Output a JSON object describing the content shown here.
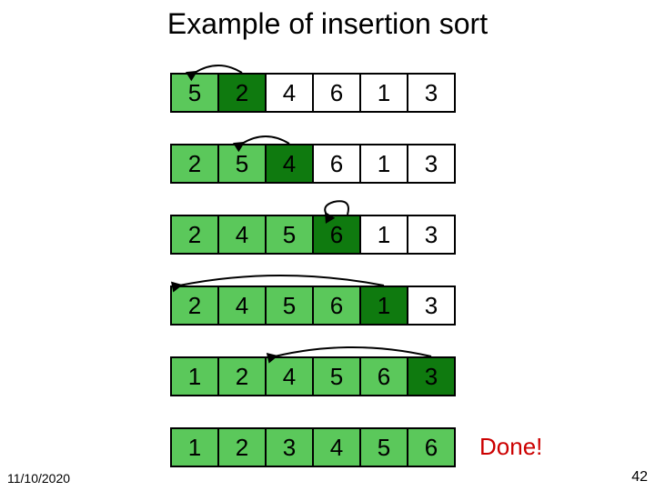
{
  "title": "Example of insertion sort",
  "footer": {
    "date": "11/10/2020",
    "page": "42"
  },
  "done_label": "Done!",
  "colors": {
    "sorted": "#5bc85b",
    "current": "#0f7a0f",
    "unsorted": "#ffffff",
    "done": "#c00000"
  },
  "rows": [
    {
      "cells": [
        {
          "value": "5",
          "state": "sorted"
        },
        {
          "value": "2",
          "state": "current"
        },
        {
          "value": "4",
          "state": "unsorted"
        },
        {
          "value": "6",
          "state": "unsorted"
        },
        {
          "value": "1",
          "state": "unsorted"
        },
        {
          "value": "3",
          "state": "unsorted"
        }
      ],
      "arrow": {
        "from": 1,
        "to": 0
      }
    },
    {
      "cells": [
        {
          "value": "2",
          "state": "sorted"
        },
        {
          "value": "5",
          "state": "sorted"
        },
        {
          "value": "4",
          "state": "current"
        },
        {
          "value": "6",
          "state": "unsorted"
        },
        {
          "value": "1",
          "state": "unsorted"
        },
        {
          "value": "3",
          "state": "unsorted"
        }
      ],
      "arrow": {
        "from": 2,
        "to": 1
      }
    },
    {
      "cells": [
        {
          "value": "2",
          "state": "sorted"
        },
        {
          "value": "4",
          "state": "sorted"
        },
        {
          "value": "5",
          "state": "sorted"
        },
        {
          "value": "6",
          "state": "current"
        },
        {
          "value": "1",
          "state": "unsorted"
        },
        {
          "value": "3",
          "state": "unsorted"
        }
      ],
      "arrow": {
        "from": 3,
        "to": 3
      }
    },
    {
      "cells": [
        {
          "value": "2",
          "state": "sorted"
        },
        {
          "value": "4",
          "state": "sorted"
        },
        {
          "value": "5",
          "state": "sorted"
        },
        {
          "value": "6",
          "state": "sorted"
        },
        {
          "value": "1",
          "state": "current"
        },
        {
          "value": "3",
          "state": "unsorted"
        }
      ],
      "arrow": {
        "from": 4,
        "to": 0
      }
    },
    {
      "cells": [
        {
          "value": "1",
          "state": "sorted"
        },
        {
          "value": "2",
          "state": "sorted"
        },
        {
          "value": "4",
          "state": "sorted"
        },
        {
          "value": "5",
          "state": "sorted"
        },
        {
          "value": "6",
          "state": "sorted"
        },
        {
          "value": "3",
          "state": "current"
        }
      ],
      "arrow": {
        "from": 5,
        "to": 2
      }
    },
    {
      "cells": [
        {
          "value": "1",
          "state": "sorted"
        },
        {
          "value": "2",
          "state": "sorted"
        },
        {
          "value": "3",
          "state": "sorted"
        },
        {
          "value": "4",
          "state": "sorted"
        },
        {
          "value": "5",
          "state": "sorted"
        },
        {
          "value": "6",
          "state": "sorted"
        }
      ],
      "done": true
    }
  ]
}
